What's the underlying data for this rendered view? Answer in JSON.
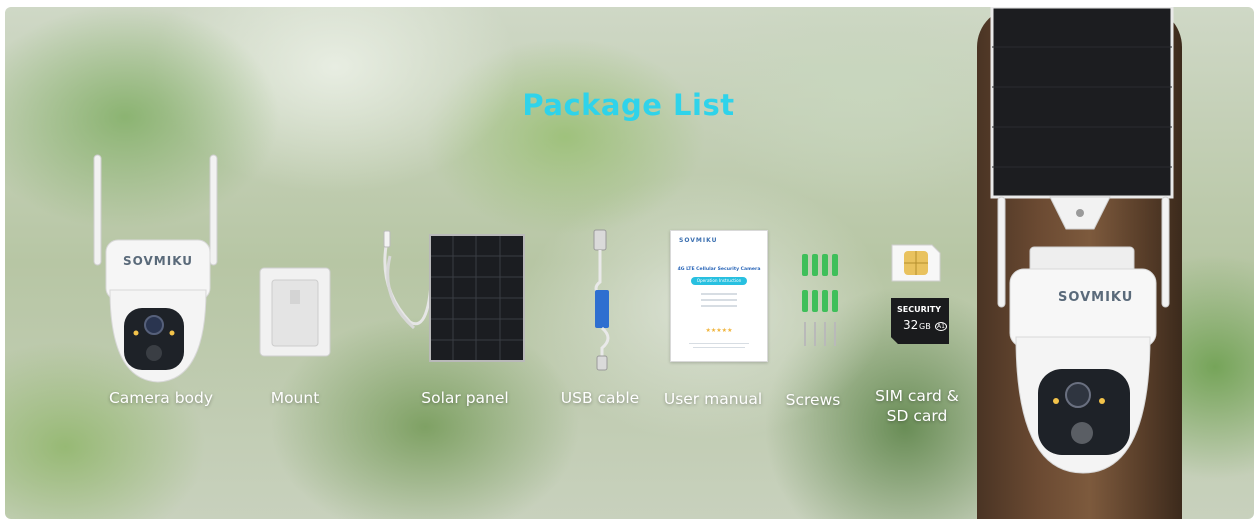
{
  "title": "Package List",
  "items": [
    {
      "label": "Camera body"
    },
    {
      "label": "Mount"
    },
    {
      "label": "Solar panel"
    },
    {
      "label": "USB cable"
    },
    {
      "label": "User manual"
    },
    {
      "label": "Screws"
    },
    {
      "label_line1": "SIM card &",
      "label_line2": "SD card"
    }
  ],
  "brand": "SOVMIKU",
  "manual": {
    "heading": "4G LTE Cellular Security Camera",
    "badge": "Operation Instruction",
    "stars": "★★★★★"
  },
  "sd_card": {
    "top": "SECURITY",
    "capacity": "32",
    "unit": "GB",
    "class": "A1"
  },
  "colors": {
    "title": "#2fd3ea",
    "label": "#ffffff",
    "usb_sleeve": "#2f6fd0"
  }
}
